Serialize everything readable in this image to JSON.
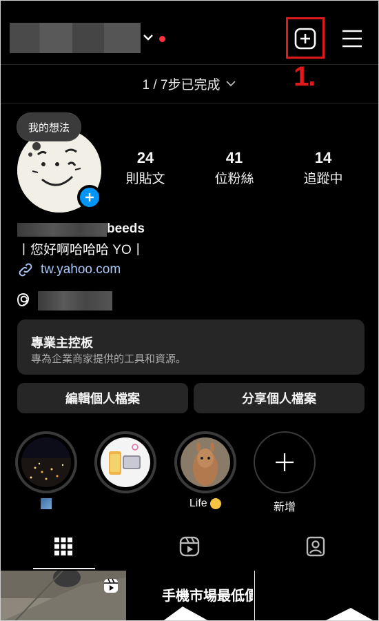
{
  "header": {
    "account_name_redacted": true,
    "notification_dot_color": "#ff3040",
    "add_icon": "plus-square-icon",
    "menu_icon": "hamburger-menu-icon",
    "annotation_label": "1.",
    "annotation_color": "#e0191b"
  },
  "progress": {
    "text": "1 / 7步已完成"
  },
  "profile": {
    "note": "我的想法",
    "stats": [
      {
        "value": "24",
        "label": "則貼文"
      },
      {
        "value": "41",
        "label": "位粉絲"
      },
      {
        "value": "14",
        "label": "追蹤中"
      }
    ],
    "name_suffix": "beeds",
    "bio": "丨您好啊哈哈哈 YO丨",
    "link": "tw.yahoo.com",
    "accent": "#0095f6"
  },
  "dashboard": {
    "title": "專業主控板",
    "subtitle": "專為企業商家提供的工具和資源。"
  },
  "buttons": {
    "edit_profile": "編輯個人檔案",
    "share_profile": "分享個人檔案"
  },
  "highlights": [
    {
      "label": ""
    },
    {
      "label": ""
    },
    {
      "label": "Life"
    },
    {
      "label": "新增"
    }
  ],
  "tabs": [
    {
      "icon": "grid-icon",
      "active": true
    },
    {
      "icon": "reels-icon",
      "active": false
    },
    {
      "icon": "tagged-icon",
      "active": false
    }
  ],
  "posts": {
    "post2_text": "手機市場最低價 -"
  }
}
